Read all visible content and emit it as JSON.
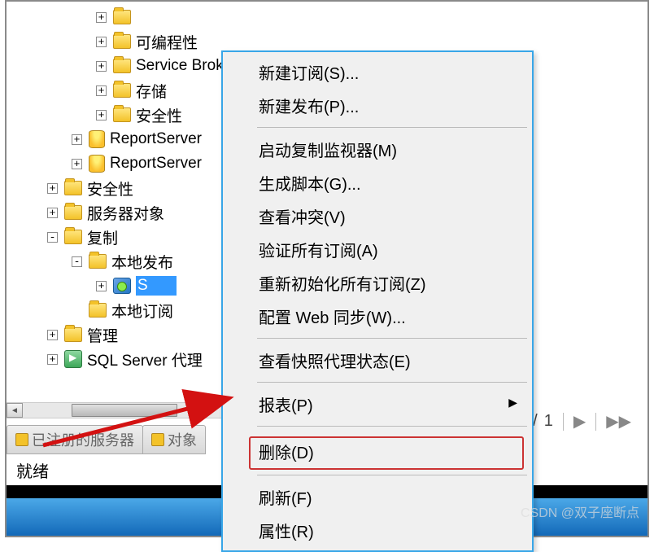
{
  "tree": [
    {
      "indent": 110,
      "exp": "+",
      "icon": "folder",
      "label": ""
    },
    {
      "indent": 110,
      "exp": "+",
      "icon": "folder",
      "label": "可编程性"
    },
    {
      "indent": 110,
      "exp": "+",
      "icon": "folder",
      "label": "Service Broker"
    },
    {
      "indent": 110,
      "exp": "+",
      "icon": "folder",
      "label": "存储"
    },
    {
      "indent": 110,
      "exp": "+",
      "icon": "folder",
      "label": "安全性"
    },
    {
      "indent": 80,
      "exp": "+",
      "icon": "db",
      "label": "ReportServer"
    },
    {
      "indent": 80,
      "exp": "+",
      "icon": "db",
      "label": "ReportServer"
    },
    {
      "indent": 50,
      "exp": "+",
      "icon": "folder",
      "label": "安全性"
    },
    {
      "indent": 50,
      "exp": "+",
      "icon": "folder",
      "label": "服务器对象"
    },
    {
      "indent": 50,
      "exp": "-",
      "icon": "folder",
      "label": "复制"
    },
    {
      "indent": 80,
      "exp": "-",
      "icon": "folder",
      "label": "本地发布"
    },
    {
      "indent": 110,
      "exp": "+",
      "icon": "pub",
      "label": "",
      "selected": true,
      "selText": "          S"
    },
    {
      "indent": 80,
      "exp": "",
      "icon": "folder",
      "label": "本地订阅"
    },
    {
      "indent": 50,
      "exp": "+",
      "icon": "folder",
      "label": "管理"
    },
    {
      "indent": 50,
      "exp": "+",
      "icon": "agent",
      "label": "SQL Server 代理"
    }
  ],
  "tabs": [
    {
      "label": "已注册的服务器"
    },
    {
      "label": "对象"
    }
  ],
  "menu": {
    "groups": [
      [
        "新建订阅(S)...",
        "新建发布(P)..."
      ],
      [
        "启动复制监视器(M)",
        "生成脚本(G)...",
        "查看冲突(V)",
        "验证所有订阅(A)",
        "重新初始化所有订阅(Z)",
        "配置 Web 同步(W)..."
      ],
      [
        "查看快照代理状态(E)"
      ],
      [
        {
          "label": "报表(P)",
          "submenu": true
        }
      ],
      [
        {
          "label": "删除(D)",
          "highlight": true
        }
      ],
      [
        "刷新(F)",
        "属性(R)"
      ]
    ]
  },
  "pager": {
    "current": "1",
    "sep": "/"
  },
  "readyText": "就绪",
  "watermark": "CSDN @双子座断点"
}
